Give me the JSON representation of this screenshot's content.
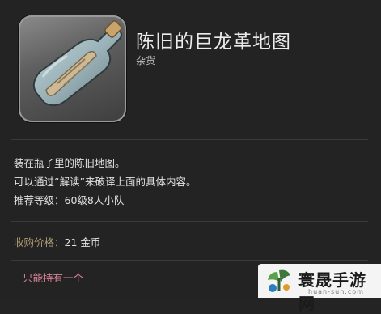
{
  "item": {
    "name": "陈旧的巨龙革地图",
    "category": "杂货",
    "icon": "bottle-map-icon"
  },
  "description": {
    "line1": "装在瓶子里的陈旧地图。",
    "line2": "可以通过“解读”来破译上面的具体内容。",
    "line3": "推荐等级：60级8人小队"
  },
  "price": {
    "label": "收购价格：",
    "value": "21 金币"
  },
  "unique_note": "只能持有一个",
  "watermark": {
    "name": "寰晟手游网",
    "url": "huan-sun.com"
  }
}
